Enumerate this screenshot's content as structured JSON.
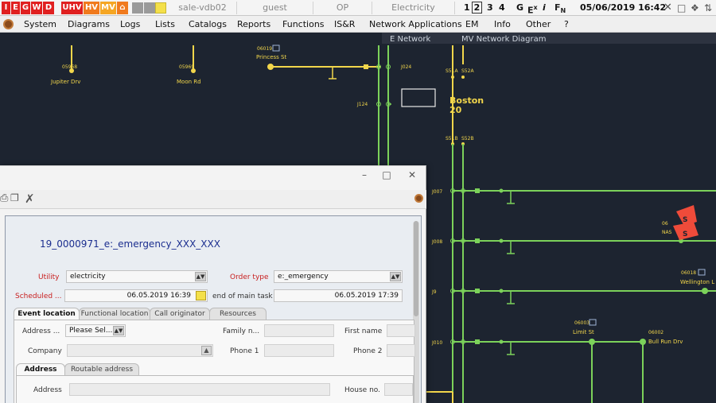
{
  "statusbar": {
    "flags": [
      {
        "label": "I",
        "color": "#e02020"
      },
      {
        "label": "E",
        "color": "#e02020"
      },
      {
        "label": "G",
        "color": "#e02020"
      },
      {
        "label": "W",
        "color": "#e02020"
      },
      {
        "label": "D",
        "color": "#e02020"
      }
    ],
    "voltage": [
      {
        "label": "UHV",
        "color": "#e02020"
      },
      {
        "label": "HV",
        "color": "#f07a1e"
      },
      {
        "label": "MV",
        "color": "#f5a623"
      }
    ],
    "server": "sale-vdb02",
    "user": "guest",
    "mode": "OP",
    "domain": "Electricity",
    "pages": [
      "1",
      "2",
      "3",
      "4"
    ],
    "active_page": "2",
    "tool_g": "G",
    "tool_ex": "E",
    "tool_ex_sup": "x",
    "tool_info": "i",
    "tool_f": "F",
    "tool_f_sub": "N",
    "datetime": "05/06/2019 16:42"
  },
  "menu": {
    "items": [
      "System",
      "Diagrams",
      "Logs",
      "Lists",
      "Catalogs",
      "Reports",
      "Functions",
      "IS&R",
      "Network Applications",
      "EM",
      "Info",
      "Other",
      "?"
    ]
  },
  "tabsbar": {
    "tab1": "E Network",
    "tab2": "MV Network Diagram"
  },
  "diagram": {
    "labels": {
      "n05968": "05968",
      "jupiter": "Jupiter Drv",
      "n05969": "05969",
      "moon": "Moon Rd",
      "n06019": "06019",
      "princess": "Princess St",
      "j024": "J024",
      "s51a": "S51A",
      "s52a": "S52A",
      "j124": "J124",
      "boston": "Boston",
      "boston_num": "20",
      "s51b": "S51B",
      "s52b": "S52B",
      "j007": "J007",
      "j008": "J008",
      "j9": "J9",
      "j010": "J010",
      "n06": "06",
      "nas": "NAS",
      "n06018": "06018",
      "wellington": "Wellington L",
      "n06003": "06003",
      "limit": "Limit St",
      "n06002": "06002",
      "bullrun": "Bull Run Drv"
    },
    "colors": {
      "background": "#1d2430",
      "mv_line": "#f2d64b",
      "lv_line": "#7cd25a",
      "alert": "#ef4b3a"
    }
  },
  "dialog": {
    "order_id": "19_0000971_e:_emergency_XXX_XXX",
    "utility_label": "Utility",
    "utility_value": "electricity",
    "order_type_label": "Order type",
    "order_type_value": "e:_emergency",
    "scheduled_label": "Scheduled ...",
    "scheduled_value": "06.05.2019 16:39",
    "end_label": "end of main task",
    "end_value": "06.05.2019 17:39",
    "tabs": [
      "Event location",
      "Functional location",
      "Call originator",
      "Resources"
    ],
    "address_label": "Address ...",
    "address_value": "Please Sel...",
    "family_label": "Family n...",
    "first_name_label": "First name",
    "company_label": "Company",
    "phone1_label": "Phone 1",
    "phone2_label": "Phone 2",
    "subtabs": [
      "Address",
      "Routable address"
    ],
    "address2_label": "Address",
    "house_label": "House no."
  }
}
